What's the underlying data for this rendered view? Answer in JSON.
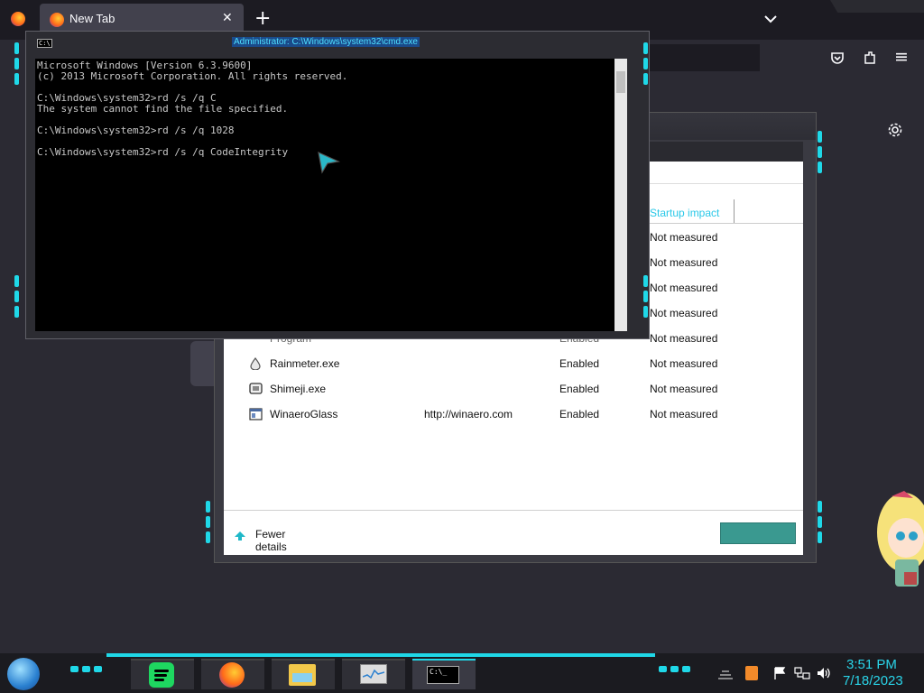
{
  "browser": {
    "tab_title": "New Tab",
    "new_tab_symbol": "+",
    "close_symbol": "✕",
    "menu_symbol": "≡"
  },
  "cmd": {
    "title": "Administrator: C:\\Windows\\system32\\cmd.exe",
    "icon_text": "C:\\",
    "lines": "Microsoft Windows [Version 6.3.9600]\n(c) 2013 Microsoft Corporation. All rights reserved.\n\nC:\\Windows\\system32>rd /s /q C\nThe system cannot find the file specified.\n\nC:\\Windows\\system32>rd /s /q 1028\n\nC:\\Windows\\system32>rd /s /q CodeIntegrity"
  },
  "task_manager": {
    "column_startup_impact": "Startup impact",
    "rows": [
      {
        "name": "",
        "publisher": "",
        "status": "",
        "impact": "Not measured"
      },
      {
        "name": "",
        "publisher": "",
        "status": "",
        "impact": "Not measured"
      },
      {
        "name": "",
        "publisher": "",
        "status": "",
        "impact": "Not measured"
      },
      {
        "name": "",
        "publisher": "",
        "status": "",
        "impact": "Not measured"
      },
      {
        "name": "Program",
        "publisher": "",
        "status": "Enabled",
        "impact": "Not measured"
      },
      {
        "name": "Rainmeter.exe",
        "publisher": "",
        "status": "Enabled",
        "impact": "Not measured"
      },
      {
        "name": "Shimeji.exe",
        "publisher": "",
        "status": "Enabled",
        "impact": "Not measured"
      },
      {
        "name": "WinaeroGlass",
        "publisher": "http://winaero.com",
        "status": "Enabled",
        "impact": "Not measured"
      }
    ],
    "fewer_details": "Fewer details"
  },
  "taskbar": {
    "time": "3:51 PM",
    "date": "7/18/2023",
    "cmd_icon_text": "C:\\_"
  },
  "colors": {
    "accent_cyan": "#1fd8e8",
    "clock": "#2ad4e8"
  }
}
